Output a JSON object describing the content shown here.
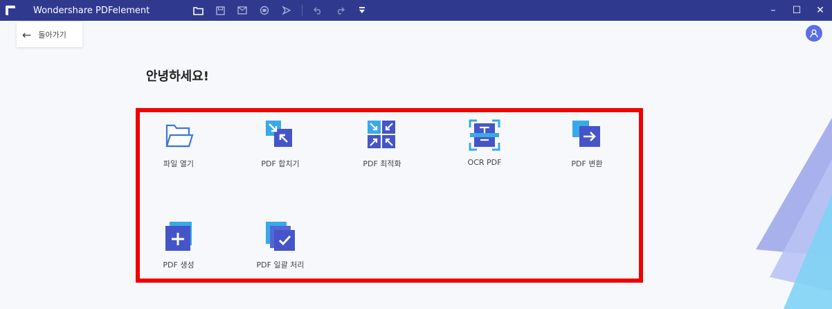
{
  "app": {
    "title": "Wondershare PDFelement"
  },
  "toolbar": {
    "icons": [
      "folder-icon",
      "save-icon",
      "mail-icon",
      "print-icon",
      "share-icon",
      "undo-icon",
      "redo-icon",
      "dropdown-icon"
    ]
  },
  "window_controls": {
    "minimize": "–",
    "maximize": "☐",
    "close": "✕"
  },
  "back": {
    "label": "돌아가기",
    "arrow": "←"
  },
  "greeting": "안녕하세요!",
  "tools": [
    {
      "label": "파일 열기",
      "icon": "folder-icon"
    },
    {
      "label": "PDF 합치기",
      "icon": "combine-icon"
    },
    {
      "label": "PDF 최적화",
      "icon": "optimize-icon"
    },
    {
      "label": "OCR PDF",
      "icon": "ocr-icon"
    },
    {
      "label": "PDF 변환",
      "icon": "convert-icon"
    },
    {
      "label": "PDF 생성",
      "icon": "create-icon"
    },
    {
      "label": "PDF 일괄 처리",
      "icon": "batch-icon"
    }
  ],
  "colors": {
    "titlebar": "#2f3a8f",
    "highlight": "#ee0000",
    "accent": "#5b6ee8"
  }
}
